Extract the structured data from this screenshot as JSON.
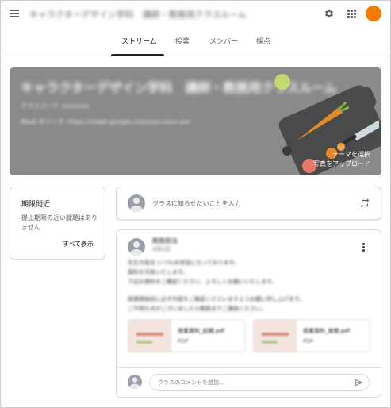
{
  "header": {
    "class_title": "キャラクターデザイン学科　講師・教務用クラスルーム"
  },
  "tabs": [
    {
      "label": "ストリーム",
      "active": true
    },
    {
      "label": "授業",
      "active": false
    },
    {
      "label": "メンバー",
      "active": false
    },
    {
      "label": "採点",
      "active": false
    }
  ],
  "banner": {
    "title": "キャラクターデザイン学科　講師・教務用クラスルーム",
    "subtitle": "クラスコード: xxxxxxx",
    "meet_link": "Meet のリンク: https://meet.google.com/xxx-xxxx-xxx",
    "action_theme": "テーマを選択",
    "action_upload": "写真をアップロード",
    "color": "#8a8a8a"
  },
  "due_card": {
    "title": "期限間近",
    "text": "提出期限の近い課題はありません",
    "view_all": "すべて表示"
  },
  "share_box": {
    "placeholder": "クラスに知らせたいことを入力"
  },
  "post": {
    "author": "教務担当",
    "date": "4月1日",
    "lines": [
      "先生方各位 いつもお世話になっております。",
      "資料を共有いたします。",
      "下記の資料をご確認ください。よろしくお願いいたします。",
      "授業開始前に必ず内容をご確認くださいますようお願い申し上げます。",
      "ご不明な点がございましたら教務までご連絡ください。"
    ],
    "attachments": [
      {
        "name": "授業資料_前期.pdf",
        "type": "PDF"
      },
      {
        "name": "授業資料_後期.pdf",
        "type": "PDF"
      }
    ],
    "comment_placeholder": "クラスのコメントを追加..."
  },
  "colors": {
    "accent": "#f57c00",
    "text_primary": "#202124",
    "text_secondary": "#5f6368"
  }
}
